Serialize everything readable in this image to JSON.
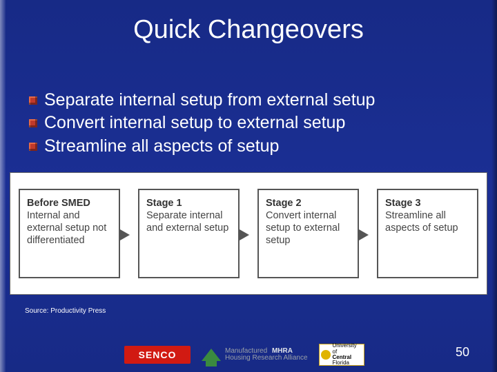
{
  "title": "Quick Changeovers",
  "bullets": [
    "Separate internal setup from external setup",
    "Convert internal setup to external setup",
    "Streamline all aspects of setup"
  ],
  "stages": [
    {
      "heading": "Before SMED",
      "body": "Internal and external setup not differentiated"
    },
    {
      "heading": "Stage 1",
      "body": "Separate internal and external setup"
    },
    {
      "heading": "Stage 2",
      "body": "Convert internal setup to external setup"
    },
    {
      "heading": "Stage 3",
      "body": "Streamline all aspects of setup"
    }
  ],
  "source_line": "Source: Productivity Press",
  "logos": {
    "senco": "SENCO",
    "mhra_line1": "Manufactured",
    "mhra_line2": "Housing Research Alliance",
    "mhra_abbrev": "MHRA",
    "ucf_line1": "University of",
    "ucf_line2": "Central",
    "ucf_line3": "Florida"
  },
  "page_number": "50"
}
